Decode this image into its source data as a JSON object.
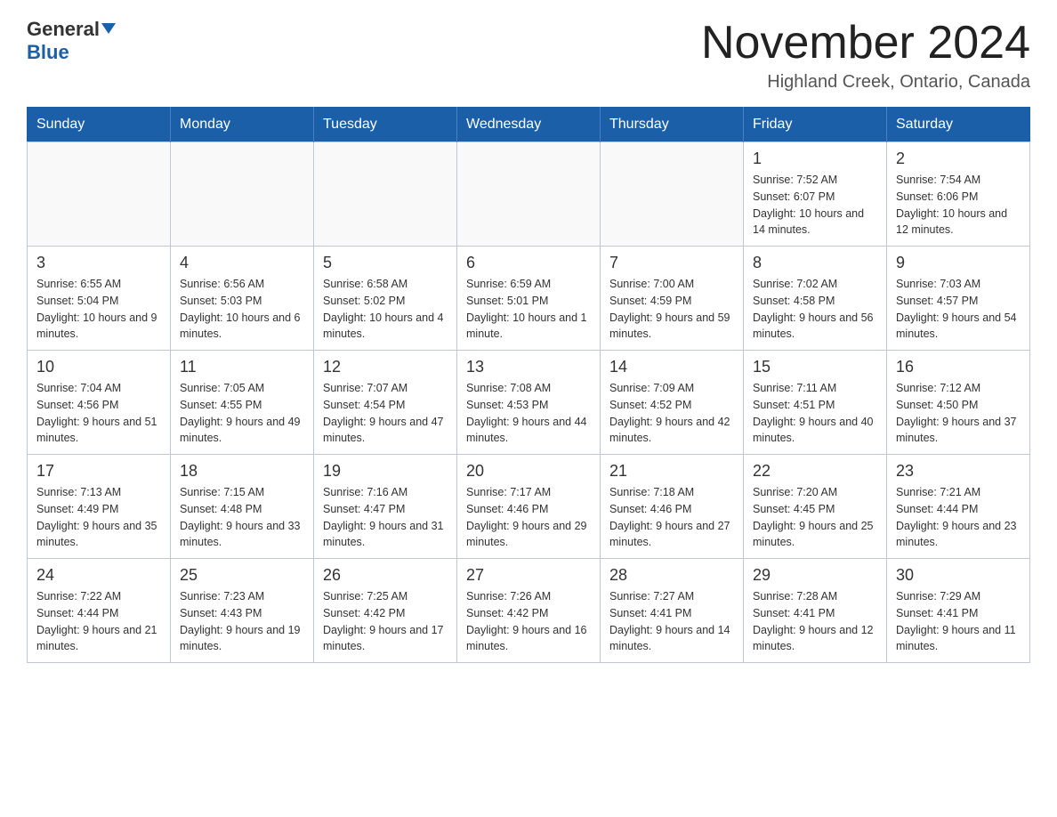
{
  "header": {
    "logo_line1": "General",
    "logo_line2": "Blue",
    "month_title": "November 2024",
    "location": "Highland Creek, Ontario, Canada"
  },
  "days_of_week": [
    "Sunday",
    "Monday",
    "Tuesday",
    "Wednesday",
    "Thursday",
    "Friday",
    "Saturday"
  ],
  "weeks": [
    [
      {
        "day": "",
        "info": ""
      },
      {
        "day": "",
        "info": ""
      },
      {
        "day": "",
        "info": ""
      },
      {
        "day": "",
        "info": ""
      },
      {
        "day": "",
        "info": ""
      },
      {
        "day": "1",
        "info": "Sunrise: 7:52 AM\nSunset: 6:07 PM\nDaylight: 10 hours and 14 minutes."
      },
      {
        "day": "2",
        "info": "Sunrise: 7:54 AM\nSunset: 6:06 PM\nDaylight: 10 hours and 12 minutes."
      }
    ],
    [
      {
        "day": "3",
        "info": "Sunrise: 6:55 AM\nSunset: 5:04 PM\nDaylight: 10 hours and 9 minutes."
      },
      {
        "day": "4",
        "info": "Sunrise: 6:56 AM\nSunset: 5:03 PM\nDaylight: 10 hours and 6 minutes."
      },
      {
        "day": "5",
        "info": "Sunrise: 6:58 AM\nSunset: 5:02 PM\nDaylight: 10 hours and 4 minutes."
      },
      {
        "day": "6",
        "info": "Sunrise: 6:59 AM\nSunset: 5:01 PM\nDaylight: 10 hours and 1 minute."
      },
      {
        "day": "7",
        "info": "Sunrise: 7:00 AM\nSunset: 4:59 PM\nDaylight: 9 hours and 59 minutes."
      },
      {
        "day": "8",
        "info": "Sunrise: 7:02 AM\nSunset: 4:58 PM\nDaylight: 9 hours and 56 minutes."
      },
      {
        "day": "9",
        "info": "Sunrise: 7:03 AM\nSunset: 4:57 PM\nDaylight: 9 hours and 54 minutes."
      }
    ],
    [
      {
        "day": "10",
        "info": "Sunrise: 7:04 AM\nSunset: 4:56 PM\nDaylight: 9 hours and 51 minutes."
      },
      {
        "day": "11",
        "info": "Sunrise: 7:05 AM\nSunset: 4:55 PM\nDaylight: 9 hours and 49 minutes."
      },
      {
        "day": "12",
        "info": "Sunrise: 7:07 AM\nSunset: 4:54 PM\nDaylight: 9 hours and 47 minutes."
      },
      {
        "day": "13",
        "info": "Sunrise: 7:08 AM\nSunset: 4:53 PM\nDaylight: 9 hours and 44 minutes."
      },
      {
        "day": "14",
        "info": "Sunrise: 7:09 AM\nSunset: 4:52 PM\nDaylight: 9 hours and 42 minutes."
      },
      {
        "day": "15",
        "info": "Sunrise: 7:11 AM\nSunset: 4:51 PM\nDaylight: 9 hours and 40 minutes."
      },
      {
        "day": "16",
        "info": "Sunrise: 7:12 AM\nSunset: 4:50 PM\nDaylight: 9 hours and 37 minutes."
      }
    ],
    [
      {
        "day": "17",
        "info": "Sunrise: 7:13 AM\nSunset: 4:49 PM\nDaylight: 9 hours and 35 minutes."
      },
      {
        "day": "18",
        "info": "Sunrise: 7:15 AM\nSunset: 4:48 PM\nDaylight: 9 hours and 33 minutes."
      },
      {
        "day": "19",
        "info": "Sunrise: 7:16 AM\nSunset: 4:47 PM\nDaylight: 9 hours and 31 minutes."
      },
      {
        "day": "20",
        "info": "Sunrise: 7:17 AM\nSunset: 4:46 PM\nDaylight: 9 hours and 29 minutes."
      },
      {
        "day": "21",
        "info": "Sunrise: 7:18 AM\nSunset: 4:46 PM\nDaylight: 9 hours and 27 minutes."
      },
      {
        "day": "22",
        "info": "Sunrise: 7:20 AM\nSunset: 4:45 PM\nDaylight: 9 hours and 25 minutes."
      },
      {
        "day": "23",
        "info": "Sunrise: 7:21 AM\nSunset: 4:44 PM\nDaylight: 9 hours and 23 minutes."
      }
    ],
    [
      {
        "day": "24",
        "info": "Sunrise: 7:22 AM\nSunset: 4:44 PM\nDaylight: 9 hours and 21 minutes."
      },
      {
        "day": "25",
        "info": "Sunrise: 7:23 AM\nSunset: 4:43 PM\nDaylight: 9 hours and 19 minutes."
      },
      {
        "day": "26",
        "info": "Sunrise: 7:25 AM\nSunset: 4:42 PM\nDaylight: 9 hours and 17 minutes."
      },
      {
        "day": "27",
        "info": "Sunrise: 7:26 AM\nSunset: 4:42 PM\nDaylight: 9 hours and 16 minutes."
      },
      {
        "day": "28",
        "info": "Sunrise: 7:27 AM\nSunset: 4:41 PM\nDaylight: 9 hours and 14 minutes."
      },
      {
        "day": "29",
        "info": "Sunrise: 7:28 AM\nSunset: 4:41 PM\nDaylight: 9 hours and 12 minutes."
      },
      {
        "day": "30",
        "info": "Sunrise: 7:29 AM\nSunset: 4:41 PM\nDaylight: 9 hours and 11 minutes."
      }
    ]
  ]
}
